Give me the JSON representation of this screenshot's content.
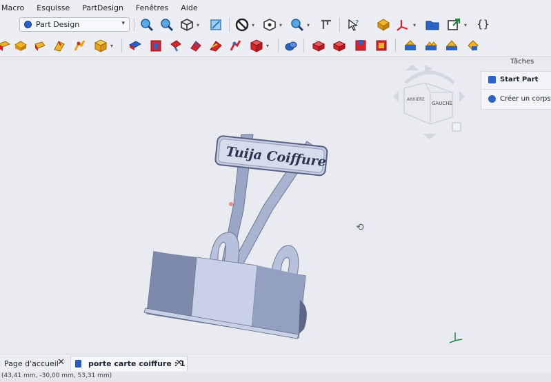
{
  "menu": [
    "Macro",
    "Esquisse",
    "PartDesign",
    "Fenêtres",
    "Aide"
  ],
  "workbench": {
    "selected": "Part Design"
  },
  "tasks": {
    "title": "Tâches",
    "items": [
      {
        "label": "Start Part"
      },
      {
        "label": "Créer un corps"
      }
    ]
  },
  "navcube": {
    "face_back": "ARRIÈRE",
    "face_left": "GAUCHE"
  },
  "model": {
    "sign_text": "Tuija Coiffure"
  },
  "tabs": [
    {
      "label": "Page d'accueil",
      "close": "✕"
    },
    {
      "label": "porte carte coiffure : 1",
      "close": "✕"
    }
  ],
  "status": {
    "coords": "(43,41 mm, -30,00 mm, 53,31 mm)"
  },
  "colors": {
    "accent": "#2c63c9",
    "part_red": "#d8232a",
    "part_yellow": "#e6a318",
    "model_fill": "#aeb9d6"
  }
}
